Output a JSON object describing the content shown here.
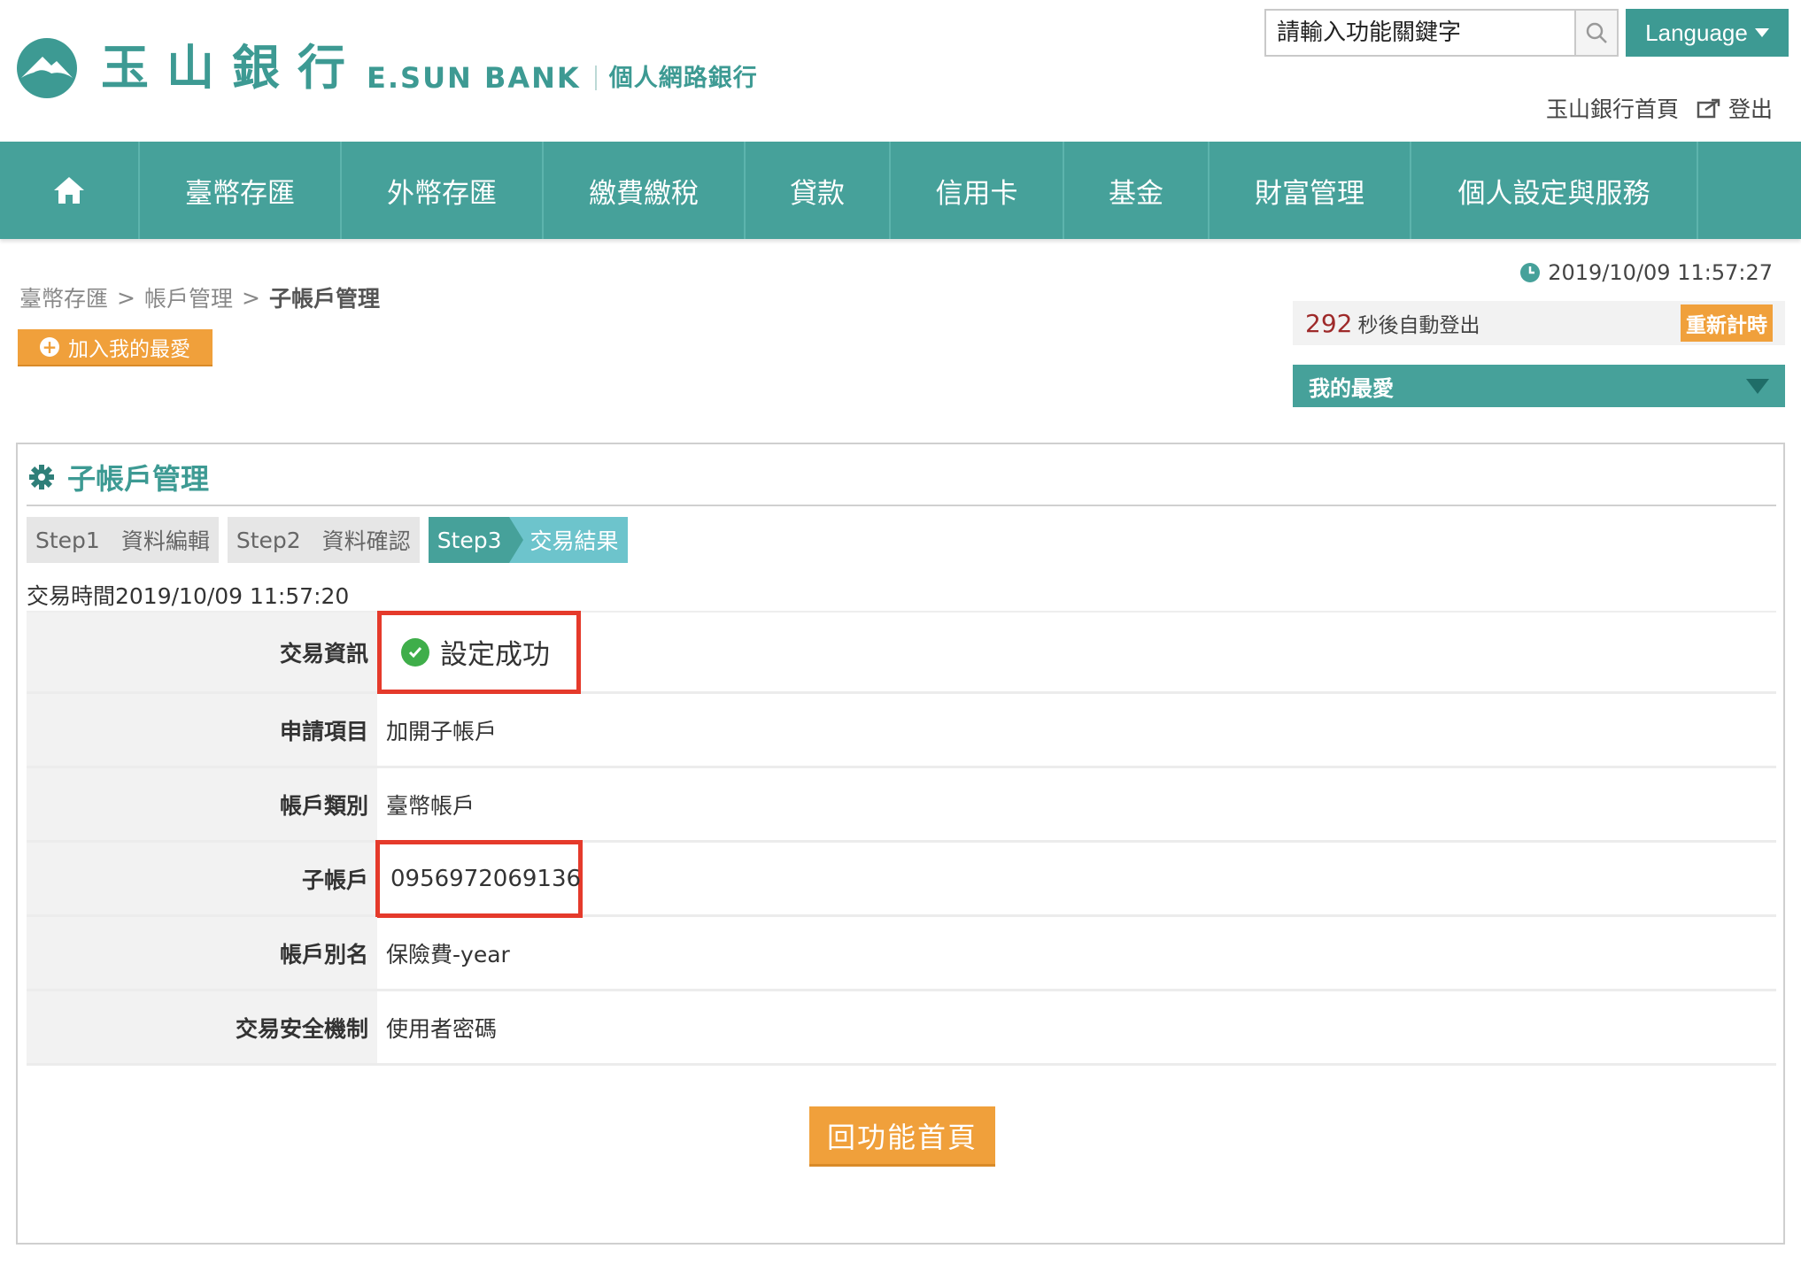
{
  "header": {
    "logo_cn": "玉山銀行",
    "logo_en": "E.SUN BANK",
    "logo_sub": "個人網路銀行",
    "search_placeholder": "請輸入功能關鍵字",
    "language_label": "Language",
    "home_link": "玉山銀行首頁",
    "logout_link": "登出"
  },
  "nav": {
    "items": [
      {
        "label": "臺幣存匯",
        "width": 228
      },
      {
        "label": "外幣存匯",
        "width": 228
      },
      {
        "label": "繳費繳稅",
        "width": 228
      },
      {
        "label": "貸款",
        "width": 164
      },
      {
        "label": "信用卡",
        "width": 196
      },
      {
        "label": "基金",
        "width": 164
      },
      {
        "label": "財富管理",
        "width": 228
      },
      {
        "label": "個人設定與服務",
        "width": 324
      }
    ]
  },
  "breadcrumb": {
    "items": [
      "臺幣存匯",
      "帳戶管理",
      "子帳戶管理"
    ],
    "separator": ">"
  },
  "add_favorite_label": "加入我的最愛",
  "session": {
    "clock": "2019/10/09 11:57:27",
    "countdown": "292",
    "countdown_text": "秒後自動登出",
    "reset_label": "重新計時",
    "my_favorites_label": "我的最愛"
  },
  "panel": {
    "title": "子帳戶管理",
    "steps": [
      {
        "no": "Step1",
        "label": "資料編輯"
      },
      {
        "no": "Step2",
        "label": "資料確認"
      },
      {
        "no": "Step3",
        "label": "交易結果"
      }
    ],
    "transaction_time": "交易時間2019/10/09 11:57:20",
    "rows": {
      "tx_info": {
        "key": "交易資訊",
        "value": "設定成功"
      },
      "apply_item": {
        "key": "申請項目",
        "value": "加開子帳戶"
      },
      "account_type": {
        "key": "帳戶類別",
        "value": "臺幣帳戶"
      },
      "sub_account": {
        "key": "子帳戶",
        "value": "0956972069136"
      },
      "account_alias": {
        "key": "帳戶別名",
        "value": "保險費-year"
      },
      "security": {
        "key": "交易安全機制",
        "value": "使用者密碼"
      }
    },
    "back_button_label": "回功能首頁"
  },
  "colors": {
    "brand_teal": "#46a19a",
    "accent_orange": "#f0a03b",
    "highlight_red": "#e53a2b",
    "success_green": "#3fae4a"
  }
}
